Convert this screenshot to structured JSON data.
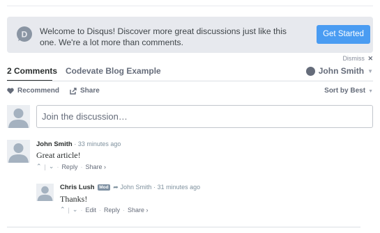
{
  "welcome": {
    "message": "Welcome to Disqus! Discover more great discussions just like this one. We're a lot more than comments.",
    "cta": "Get Started",
    "dismiss": "Dismiss"
  },
  "tabs": {
    "comments": "2 Comments",
    "community": "Codevate Blog Example"
  },
  "user": {
    "name": "John Smith"
  },
  "actions": {
    "recommend": "Recommend",
    "share": "Share",
    "sort": "Sort by Best"
  },
  "composer": {
    "placeholder": "Join the discussion…"
  },
  "comments": [
    {
      "author": "John Smith",
      "time": "33 minutes ago",
      "body": "Great article!",
      "reply": "Reply",
      "share": "Share ›"
    },
    {
      "author": "Chris Lush",
      "badge": "Mod",
      "reply_to": "John Smith",
      "time": "31 minutes ago",
      "body": "Thanks!",
      "edit": "Edit",
      "reply": "Reply",
      "share": "Share ›"
    }
  ],
  "icons": [
    "disqus-logo-icon",
    "heart-icon",
    "share-icon",
    "upvote-icon",
    "downvote-icon",
    "reply-arrow-icon",
    "dismiss-x-icon"
  ],
  "colors": {
    "accent": "#4a9cf2",
    "banner_bg": "#e7e9ee",
    "text": "#2a2e2e",
    "muted": "#656c7a"
  }
}
